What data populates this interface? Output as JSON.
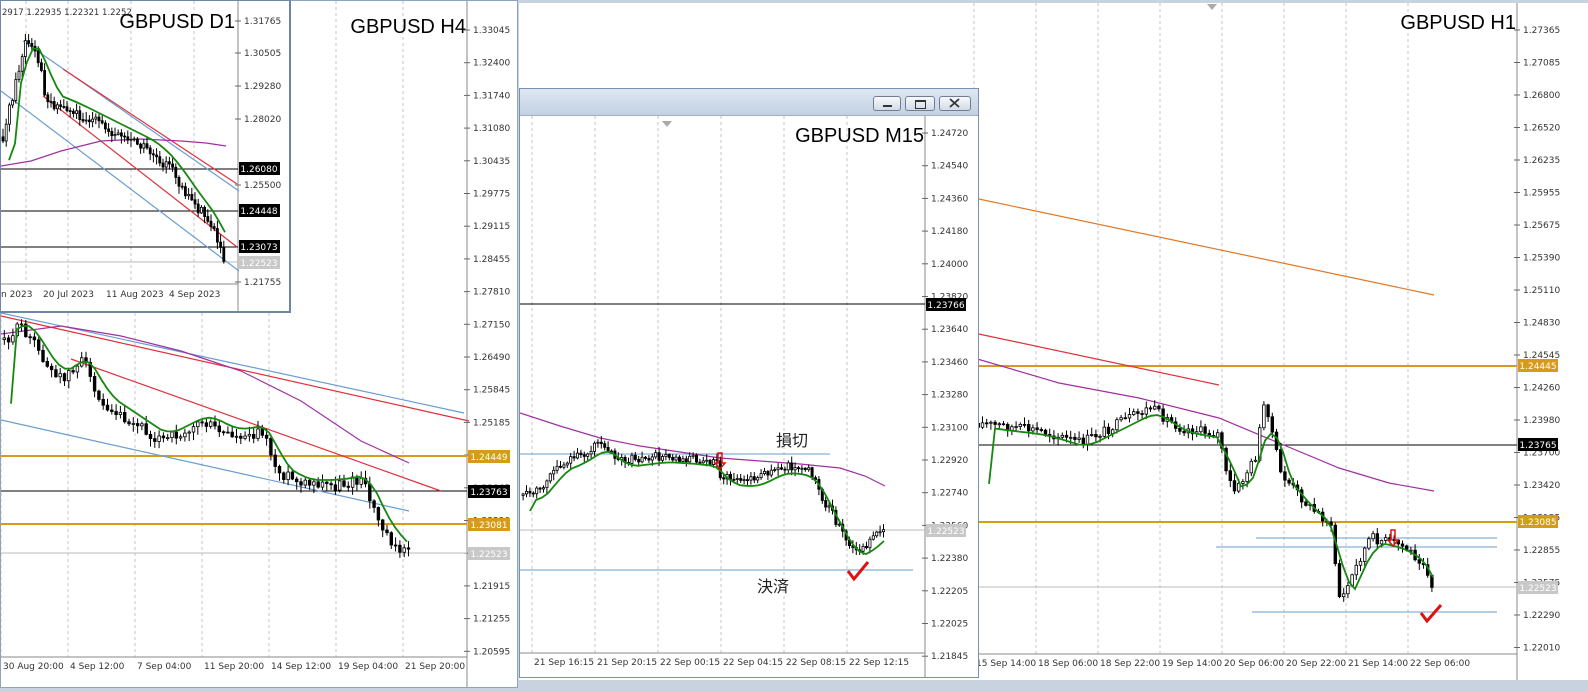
{
  "charts": {
    "h1": {
      "title": "GBPUSD H1",
      "price_ticks": [
        "1.27365",
        "1.27085",
        "1.26800",
        "1.26520",
        "1.26235",
        "1.25955",
        "1.25675",
        "1.25390",
        "1.25110",
        "1.24830",
        "1.24545",
        "1.24260",
        "1.23980",
        "1.23700",
        "1.23420",
        "1.23135",
        "1.22855",
        "1.22575",
        "1.22290",
        "1.22010"
      ],
      "time_ticks": [
        "15 Sep 14:00",
        "18 Sep 06:00",
        "18 Sep 22:00",
        "19 Sep 14:00",
        "20 Sep 06:00",
        "20 Sep 22:00",
        "21 Sep 14:00",
        "22 Sep 06:00"
      ],
      "price_labels": {
        "upper": "1.24445",
        "black": "1.23765",
        "lower": "1.23085",
        "current": "1.22523"
      }
    },
    "h4": {
      "title": "GBPUSD H4",
      "price_ticks": [
        "1.33045",
        "1.32400",
        "1.31740",
        "1.31080",
        "1.30435",
        "1.29775",
        "1.29115",
        "1.28455",
        "1.27810",
        "1.27150",
        "1.26490",
        "1.25845",
        "1.25185",
        "1.24525",
        "1.23865",
        "1.23220",
        "1.22560",
        "1.21915",
        "1.21255",
        "1.20595"
      ],
      "time_ticks": [
        "30 Aug 20:00",
        "4 Sep 12:00",
        "7 Sep 04:00",
        "11 Sep 20:00",
        "14 Sep 12:00",
        "19 Sep 04:00",
        "21 Sep 20:00"
      ],
      "price_labels": {
        "upper": "1.24449",
        "black": "1.23763",
        "lower": "1.23081",
        "current": "1.22523"
      }
    },
    "d1": {
      "title": "GBPUSD D1",
      "ohlc_text": "2917 1.22935 1.22321 1.2252",
      "price_ticks": [
        "1.31765",
        "1.30505",
        "1.29280",
        "1.28020",
        "1.25500",
        "1.21755"
      ],
      "time_ticks": [
        "n 2023",
        "20 Jul 2023",
        "11 Aug 2023",
        "4 Sep 2023"
      ],
      "price_labels": {
        "a": "1.26080",
        "b": "1.24448",
        "c": "1.23073",
        "current": "1.22523"
      }
    },
    "m15": {
      "title": "GBPUSD M15",
      "price_ticks": [
        "1.24720",
        "1.24540",
        "1.24360",
        "1.24180",
        "1.24000",
        "1.23820",
        "1.23640",
        "1.23460",
        "1.23280",
        "1.23100",
        "1.22920",
        "1.22740",
        "1.22560",
        "1.22380",
        "1.22205",
        "1.22025",
        "1.21845"
      ],
      "time_ticks": [
        "21 Sep 16:15",
        "21 Sep 20:15",
        "22 Sep 00:15",
        "22 Sep 04:15",
        "22 Sep 08:15",
        "22 Sep 12:15"
      ],
      "price_labels": {
        "black": "1.23766",
        "current": "1.22523"
      },
      "annotations": {
        "stop": "損切",
        "close": "決済"
      }
    }
  },
  "colors": {
    "ma_green": "#15880f",
    "ma_purple": "#a030a0",
    "ma_orange": "#e07828",
    "trend_red": "#e0303c",
    "trend_blue": "#6a9ed0",
    "level_gold": "#d89a1a",
    "check_red": "#e01010"
  }
}
